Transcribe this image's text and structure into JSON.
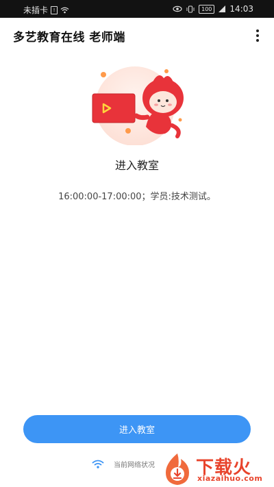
{
  "status_bar": {
    "carrier": "未插卡",
    "battery": "100",
    "time": "14:03"
  },
  "app_bar": {
    "title": "多艺教育在线 老师端",
    "menu_icon": "more-vertical-icon"
  },
  "classroom": {
    "title": "进入教室",
    "schedule": "16:00:00-17:00:00；学员:技术测试。"
  },
  "actions": {
    "enter_button": "进入教室"
  },
  "network": {
    "icon": "wifi-icon",
    "label": "当前网络状况"
  },
  "watermark": {
    "text": "下载火",
    "domain": "xiazaihuo.com"
  },
  "colors": {
    "accent": "#3d95f5",
    "mascot": "#e8333a",
    "watermark": "#e8442c"
  }
}
